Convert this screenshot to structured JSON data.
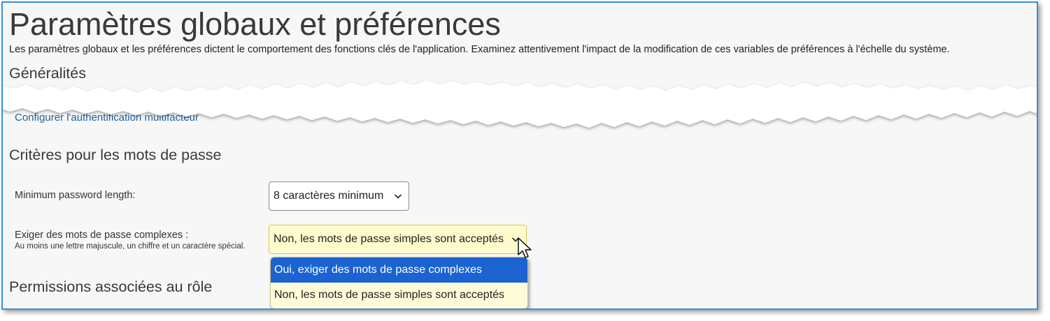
{
  "page": {
    "title": "Paramètres globaux et préférences",
    "description": "Les paramètres globaux et les préférences dictent le comportement des fonctions clés de l'application. Examinez attentivement l'impact de la modification de ces variables de préférences à l'échelle du système."
  },
  "sections": {
    "general": {
      "heading": "Généralités",
      "mfa_link": "Configurer l'authentification multifacteur"
    },
    "password": {
      "heading": "Critères pour les mots de passe",
      "min_length": {
        "label": "Minimum password length:",
        "value": "8 caractères minimum"
      },
      "complex": {
        "label": "Exiger des mots de passe complexes :",
        "hint": "Au moins une lettre majuscule, un chiffre et un caractère spécial.",
        "value": "Non, les mots de passe simples sont acceptés",
        "options": [
          "Oui, exiger des mots de passe complexes",
          "Non, les mots de passe simples sont acceptés"
        ]
      }
    },
    "roles": {
      "heading": "Permissions associées au rôle"
    }
  },
  "colors": {
    "frame_border": "#3a8fd6",
    "link": "#1f5f9e",
    "highlight_bg": "#fffbcc",
    "option_selected": "#1a63d1"
  },
  "icons": {
    "select_arrow": "chevron-down-icon",
    "pointer": "mouse-cursor-icon"
  }
}
